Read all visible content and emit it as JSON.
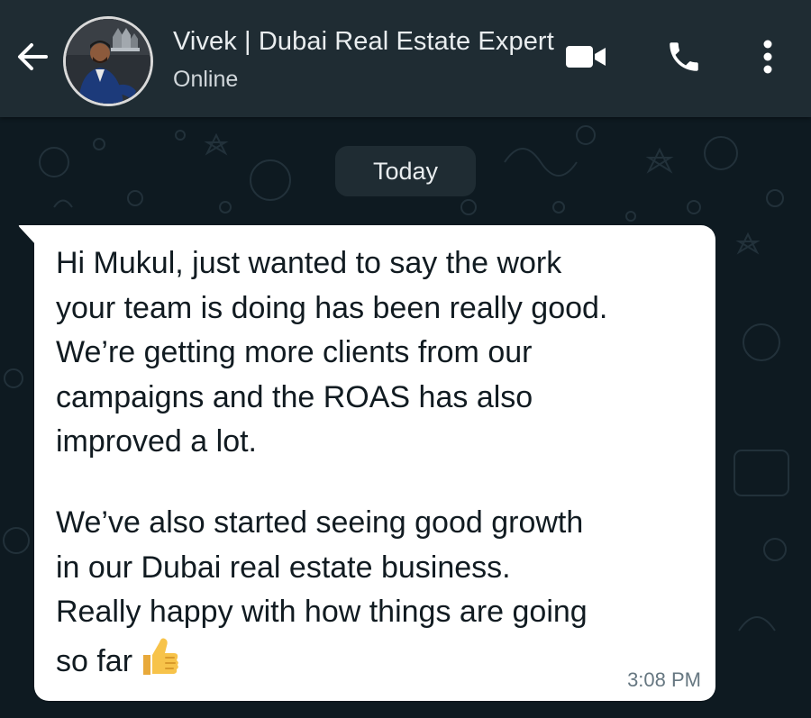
{
  "header": {
    "back_label": "Back",
    "contact_name": "Vivek | Dubai Real Estate Expert",
    "status": "Online",
    "icons": [
      "arrow-left-icon",
      "video-call-icon",
      "phone-icon",
      "more-vertical-icon"
    ]
  },
  "chat": {
    "date_divider": "Today",
    "message": {
      "paragraph_1": "Hi Mukul, just wanted to say the work\nyour team is doing has been really good.\nWe’re getting more clients from our\ncampaigns and the ROAS has also\nimproved a lot.",
      "paragraph_2": "We’ve also started seeing good growth\nin our Dubai real estate business.\nReally happy with how things are going\nso far",
      "emoji": "thumbs-up",
      "time": "3:08 PM"
    }
  },
  "colors": {
    "header_bg": "#1f2c33",
    "chat_bg": "#0e1a21",
    "bubble_bg": "#ffffff",
    "text_primary": "#111b21",
    "header_text": "#e9edef"
  }
}
